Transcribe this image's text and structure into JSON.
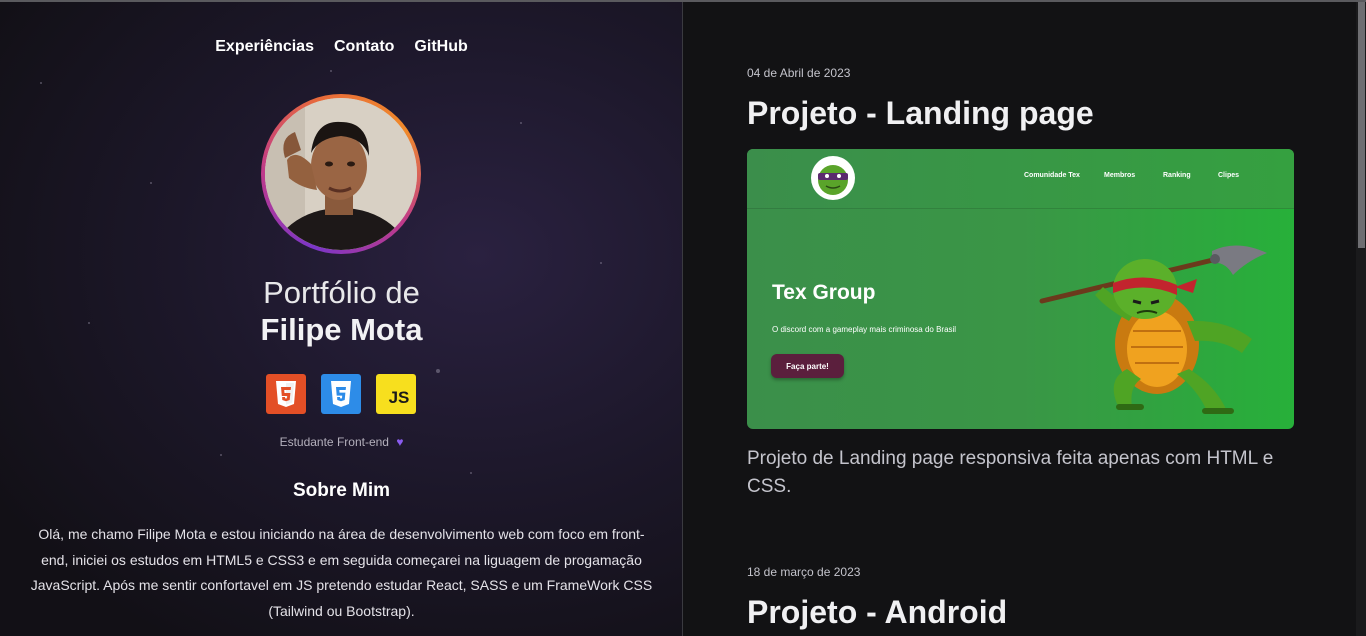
{
  "nav": {
    "items": [
      {
        "label": "Experiências"
      },
      {
        "label": "Contato"
      },
      {
        "label": "GitHub"
      }
    ]
  },
  "profile": {
    "title_line1": "Portfólio de",
    "title_line2": "Filipe Mota",
    "badges": [
      {
        "icon": "html5-icon",
        "label": "",
        "color": "#e34f26"
      },
      {
        "icon": "css3-icon",
        "label": "",
        "color": "#2d8ce8"
      },
      {
        "icon": "javascript-icon",
        "label": "JS",
        "color": "#f7df1e"
      }
    ],
    "role": "Estudante Front-end",
    "heart_icon": "heart-icon",
    "heart_color": "#8a5cf0"
  },
  "about": {
    "title": "Sobre Mim",
    "text": "Olá, me chamo Filipe Mota e estou iniciando na área de desenvolvimento web com foco em front-end, iniciei os estudos em HTML5 e CSS3 e em seguida começarei na liguagem de progamação JavaScript. Após me sentir confortavel em JS pretendo estudar React, SASS e um FrameWork CSS (Tailwind ou Bootstrap)."
  },
  "projects": [
    {
      "date": "04 de Abril de 2023",
      "title": "Projeto - Landing page",
      "description": "Projeto de Landing page responsiva feita apenas com HTML e CSS.",
      "preview": {
        "nav": [
          "Comunidade Tex",
          "Membros",
          "Ranking",
          "Clipes"
        ],
        "brand": "Tex Group",
        "subtitle": "O discord com a gameplay mais criminosa do Brasil",
        "button": "Faça parte!"
      }
    },
    {
      "date": "18 de março de 2023",
      "title": "Projeto - Android"
    }
  ]
}
